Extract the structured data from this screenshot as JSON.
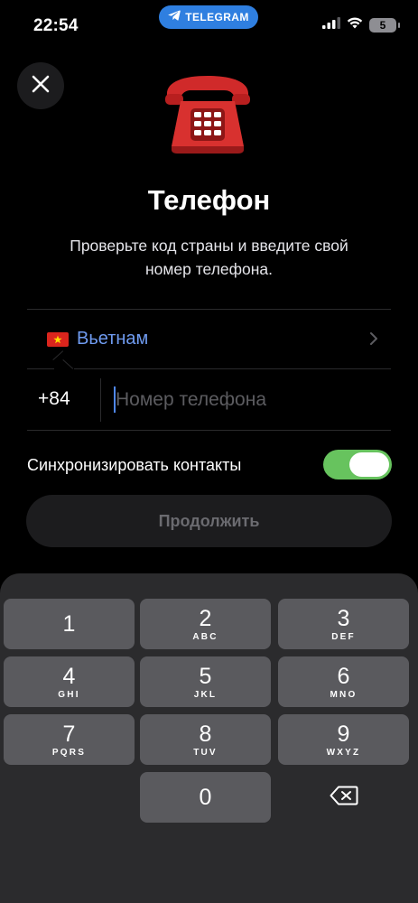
{
  "status_bar": {
    "time": "22:54",
    "app_pill": "TELEGRAM",
    "battery": "5",
    "icons": [
      "cellular-signal-icon",
      "wifi-icon",
      "battery-icon"
    ]
  },
  "header": {
    "close_icon": "close-icon",
    "illustration": "telephone-emoji",
    "title": "Телефон",
    "subtitle": "Проверьте код страны и введите свой номер телефона."
  },
  "form": {
    "country_name": "Вьетнам",
    "country_flag": "vietnam-flag-icon",
    "country_code": "+84",
    "phone_value": "",
    "phone_placeholder": "Номер телефона",
    "sync_label": "Синхронизировать контакты",
    "sync_enabled": true,
    "continue_label": "Продолжить"
  },
  "keypad": {
    "keys": [
      {
        "num": "1",
        "letters": ""
      },
      {
        "num": "2",
        "letters": "ABC"
      },
      {
        "num": "3",
        "letters": "DEF"
      },
      {
        "num": "4",
        "letters": "GHI"
      },
      {
        "num": "5",
        "letters": "JKL"
      },
      {
        "num": "6",
        "letters": "MNO"
      },
      {
        "num": "7",
        "letters": "PQRS"
      },
      {
        "num": "8",
        "letters": "TUV"
      },
      {
        "num": "9",
        "letters": "WXYZ"
      },
      {
        "num": "0",
        "letters": ""
      }
    ],
    "backspace_icon": "backspace-icon"
  },
  "colors": {
    "accent_link": "#6f9bf0",
    "toggle_on": "#67c35e",
    "telegram_blue": "#2f7fe0",
    "flag_red": "#da251d",
    "flag_star": "#ffde00"
  }
}
